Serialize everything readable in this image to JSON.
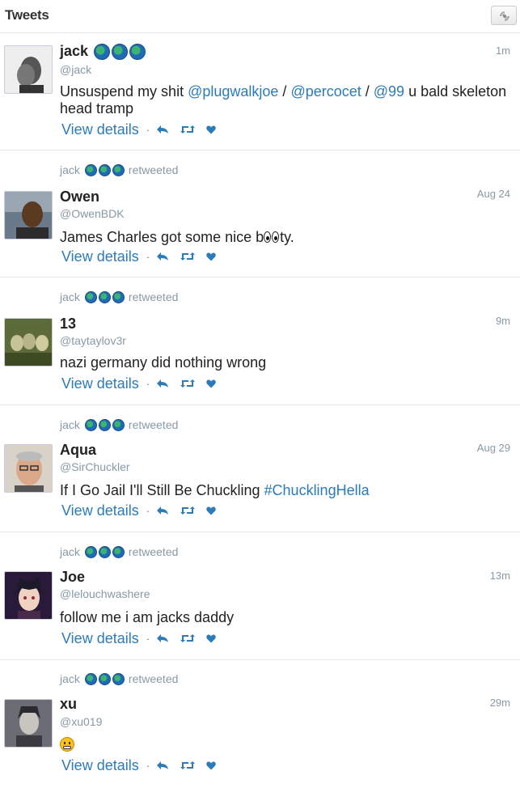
{
  "header": {
    "title": "Tweets",
    "refresh_icon": "refresh-icon"
  },
  "retweeter_label": "jack",
  "retweeted_word": "retweeted",
  "view_details": "View details",
  "separator": "·",
  "icons": {
    "reply": "reply-icon",
    "retweet": "retweet-icon",
    "like": "heart-icon",
    "badge": "globe-icon"
  },
  "colors": {
    "link": "#2b7bb9",
    "muted": "#8899a6",
    "border": "#e1e8ed"
  },
  "tweets": [
    {
      "name": "jack",
      "handle": "@jack",
      "time": "1m",
      "text_parts": [
        "Unsuspend my shit ",
        "@plugwalkjoe",
        " / ",
        "@percocet",
        " / ",
        "@99",
        " u bald skeleton head tramp"
      ]
    },
    {
      "name": "Owen",
      "handle": "@OwenBDK",
      "time": "Aug 24",
      "text_before": "James Charles got some nice b",
      "text_after": "ty."
    },
    {
      "name": "13",
      "handle": "@taytaylov3r",
      "time": "9m",
      "text": "nazi germany did nothing wrong"
    },
    {
      "name": "Aqua",
      "handle": "@SirChuckler",
      "time": "Aug 29",
      "text_plain": "If I Go Jail I'll Still Be Chuckling ",
      "hashtag": "#ChucklingHella"
    },
    {
      "name": "Joe",
      "handle": "@lelouchwashere",
      "time": "13m",
      "text": "follow me i am jacks daddy"
    },
    {
      "name": "xu",
      "handle": "@xu019",
      "time": "29m"
    }
  ]
}
